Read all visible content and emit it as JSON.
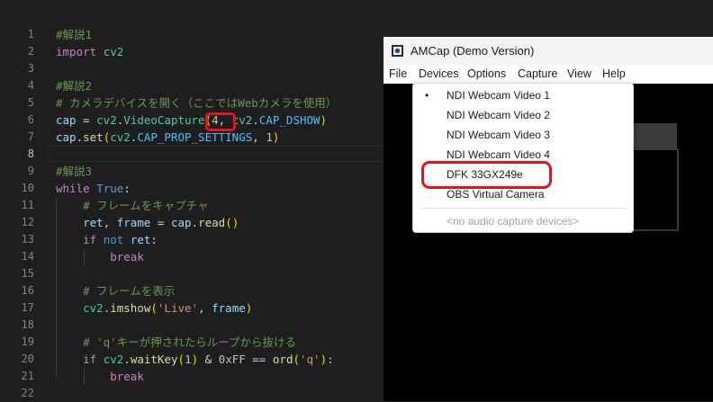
{
  "editor": {
    "line_numbers": [
      "1",
      "2",
      "3",
      "4",
      "5",
      "6",
      "7",
      "8",
      "9",
      "10",
      "11",
      "12",
      "13",
      "14",
      "15",
      "16",
      "17",
      "18",
      "19",
      "20",
      "21",
      "22"
    ],
    "active_line": "8",
    "lines": [
      [
        {
          "t": "#解説1",
          "c": "c-com"
        }
      ],
      [
        {
          "t": "import",
          "c": "c-ctl"
        },
        {
          "t": " ",
          "c": "c-op"
        },
        {
          "t": "cv2",
          "c": "c-cls"
        }
      ],
      [],
      [
        {
          "t": "#解説2",
          "c": "c-com"
        }
      ],
      [
        {
          "t": "# カメラデバイスを開く（ここではWebカメラを使用）",
          "c": "c-com"
        }
      ],
      [
        {
          "t": "cap",
          "c": "c-var"
        },
        {
          "t": " = ",
          "c": "c-op"
        },
        {
          "t": "cv2",
          "c": "c-cls"
        },
        {
          "t": ".",
          "c": "c-op"
        },
        {
          "t": "VideoCapture",
          "c": "c-cls"
        },
        {
          "t": "(",
          "c": "c-br"
        },
        {
          "t": "4",
          "c": "c-num"
        },
        {
          "t": ", ",
          "c": "c-op"
        },
        {
          "t": "cv2",
          "c": "c-cls"
        },
        {
          "t": ".",
          "c": "c-op"
        },
        {
          "t": "CAP_DSHOW",
          "c": "c-con"
        },
        {
          "t": ")",
          "c": "c-br"
        }
      ],
      [
        {
          "t": "cap",
          "c": "c-var"
        },
        {
          "t": ".",
          "c": "c-op"
        },
        {
          "t": "set",
          "c": "c-fn"
        },
        {
          "t": "(",
          "c": "c-br"
        },
        {
          "t": "cv2",
          "c": "c-cls"
        },
        {
          "t": ".",
          "c": "c-op"
        },
        {
          "t": "CAP_PROP_SETTINGS",
          "c": "c-con"
        },
        {
          "t": ", ",
          "c": "c-op"
        },
        {
          "t": "1",
          "c": "c-num"
        },
        {
          "t": ")",
          "c": "c-br"
        }
      ],
      [],
      [
        {
          "t": "#解説3",
          "c": "c-com"
        }
      ],
      [
        {
          "t": "while",
          "c": "c-ctl"
        },
        {
          "t": " ",
          "c": "c-op"
        },
        {
          "t": "True",
          "c": "c-kw"
        },
        {
          "t": ":",
          "c": "c-op"
        }
      ],
      [
        {
          "t": "    ",
          "c": "c-op"
        },
        {
          "t": "# フレームをキャプチャ",
          "c": "c-com"
        }
      ],
      [
        {
          "t": "    ",
          "c": "c-op"
        },
        {
          "t": "ret",
          "c": "c-var"
        },
        {
          "t": ", ",
          "c": "c-op"
        },
        {
          "t": "frame",
          "c": "c-var"
        },
        {
          "t": " = ",
          "c": "c-op"
        },
        {
          "t": "cap",
          "c": "c-var"
        },
        {
          "t": ".",
          "c": "c-op"
        },
        {
          "t": "read",
          "c": "c-fn"
        },
        {
          "t": "()",
          "c": "c-br"
        }
      ],
      [
        {
          "t": "    ",
          "c": "c-op"
        },
        {
          "t": "if",
          "c": "c-ctl"
        },
        {
          "t": " ",
          "c": "c-op"
        },
        {
          "t": "not",
          "c": "c-kw"
        },
        {
          "t": " ",
          "c": "c-op"
        },
        {
          "t": "ret",
          "c": "c-var"
        },
        {
          "t": ":",
          "c": "c-op"
        }
      ],
      [
        {
          "t": "        ",
          "c": "c-op"
        },
        {
          "t": "break",
          "c": "c-ctl"
        }
      ],
      [],
      [
        {
          "t": "    ",
          "c": "c-op"
        },
        {
          "t": "# フレームを表示",
          "c": "c-com"
        }
      ],
      [
        {
          "t": "    ",
          "c": "c-op"
        },
        {
          "t": "cv2",
          "c": "c-cls"
        },
        {
          "t": ".",
          "c": "c-op"
        },
        {
          "t": "imshow",
          "c": "c-fn"
        },
        {
          "t": "(",
          "c": "c-br"
        },
        {
          "t": "'Live'",
          "c": "c-str"
        },
        {
          "t": ", ",
          "c": "c-op"
        },
        {
          "t": "frame",
          "c": "c-var"
        },
        {
          "t": ")",
          "c": "c-br"
        }
      ],
      [],
      [
        {
          "t": "    ",
          "c": "c-op"
        },
        {
          "t": "# 'q'キーが押されたらループから抜ける",
          "c": "c-com"
        }
      ],
      [
        {
          "t": "    ",
          "c": "c-op"
        },
        {
          "t": "if",
          "c": "c-ctl"
        },
        {
          "t": " ",
          "c": "c-op"
        },
        {
          "t": "cv2",
          "c": "c-cls"
        },
        {
          "t": ".",
          "c": "c-op"
        },
        {
          "t": "waitKey",
          "c": "c-fn"
        },
        {
          "t": "(",
          "c": "c-br"
        },
        {
          "t": "1",
          "c": "c-num"
        },
        {
          "t": ")",
          "c": "c-br"
        },
        {
          "t": " & ",
          "c": "c-op"
        },
        {
          "t": "0xFF",
          "c": "c-num"
        },
        {
          "t": " == ",
          "c": "c-op"
        },
        {
          "t": "ord",
          "c": "c-fn"
        },
        {
          "t": "(",
          "c": "c-br"
        },
        {
          "t": "'q'",
          "c": "c-str"
        },
        {
          "t": ")",
          "c": "c-br"
        },
        {
          "t": ":",
          "c": "c-op"
        }
      ],
      [
        {
          "t": "        ",
          "c": "c-op"
        },
        {
          "t": "break",
          "c": "c-ctl"
        }
      ],
      []
    ]
  },
  "amcap": {
    "title": "AMCap (Demo Version)",
    "icon": "webcam-icon",
    "menu": [
      "File",
      "Devices",
      "Options",
      "Capture",
      "View",
      "Help"
    ]
  },
  "devices_menu": {
    "selected_marker": "•",
    "items": [
      "NDI Webcam Video 1",
      "NDI Webcam Video 2",
      "NDI Webcam Video 3",
      "NDI Webcam Video 4",
      "DFK 33GX249e",
      "OBS Virtual Camera"
    ],
    "selected_index": 0,
    "disabled_item": "<no audio capture devices>"
  },
  "highlight_color": "#e0141e"
}
